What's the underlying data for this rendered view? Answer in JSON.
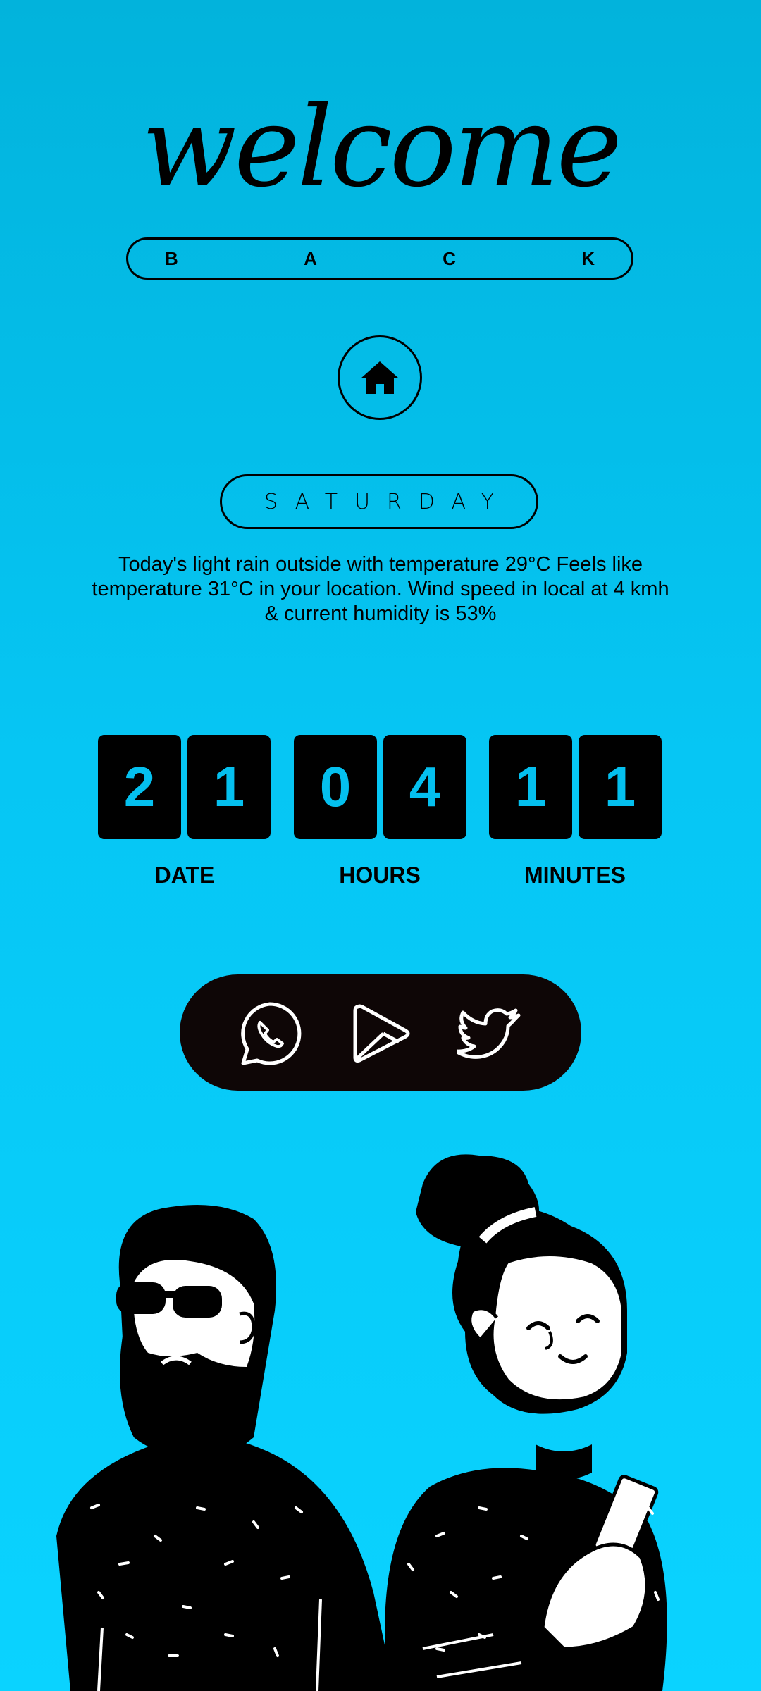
{
  "header": {
    "title": "welcome",
    "subtitle_letters": [
      "B",
      "A",
      "C",
      "K"
    ]
  },
  "home": {
    "icon": "home-icon"
  },
  "day": {
    "label": "SATURDAY"
  },
  "weather": {
    "text": "Today's light rain outside with temperature 29°C Feels like temperature 31°C in your location. Wind speed in local at 4 kmh & current humidity is 53%"
  },
  "clock": {
    "date_digits": [
      "2",
      "1"
    ],
    "hour_digits": [
      "0",
      "4"
    ],
    "minute_digits": [
      "1",
      "1"
    ],
    "labels": {
      "date": "DATE",
      "hours": "HOURS",
      "minutes": "MINUTES"
    }
  },
  "social": {
    "icons": [
      "whatsapp-icon",
      "play-store-icon",
      "twitter-icon"
    ]
  },
  "colors": {
    "background_top": "#02b3dc",
    "background_bottom": "#0ad3ff",
    "digit_box": "#000000",
    "digit_text": "#04c0ef",
    "social_bar": "#0e0606"
  }
}
